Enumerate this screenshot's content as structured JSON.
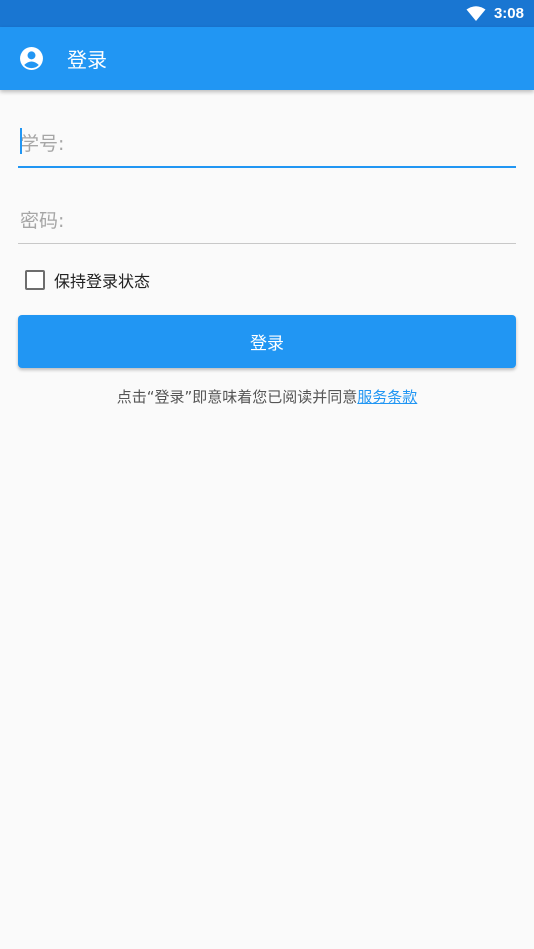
{
  "status_bar": {
    "time": "3:08",
    "wifi_icon": "wifi-icon"
  },
  "app_bar": {
    "icon": "account-circle-icon",
    "title": "登录"
  },
  "form": {
    "student_id": {
      "placeholder": "学号:",
      "value": ""
    },
    "password": {
      "placeholder": "密码:",
      "value": ""
    },
    "remember_label": "保持登录状态",
    "remember_checked": false,
    "login_button_label": "登录"
  },
  "terms": {
    "prefix": "点击“登录”即意味着您已阅读并同意",
    "link": "服务条款"
  },
  "colors": {
    "primary": "#2196f3",
    "primary_dark": "#1976d2",
    "background": "#fafafa"
  }
}
